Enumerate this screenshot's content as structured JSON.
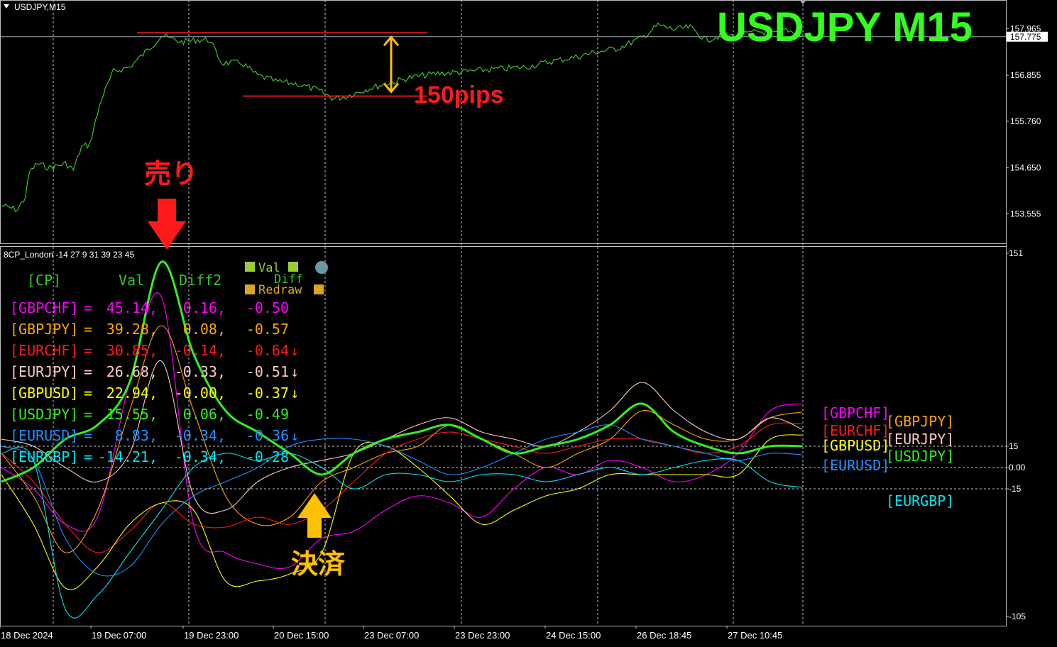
{
  "window": {
    "title": "USDJPY,M15",
    "big_title": "USDJPY  M15",
    "dropdown_icon": "triangle-down-icon"
  },
  "colors": {
    "background": "#000000",
    "price_line": "#3fbf2f",
    "big_title": "#33ff1f",
    "annotation_red": "#ff1a1a",
    "annotation_yellow": "#ffc000",
    "grid": "#c8c8c8"
  },
  "annotations": {
    "pips_label": "150pips",
    "sell_label": "売り",
    "settle_label": "決済"
  },
  "indicator": {
    "title": "8CP_London -14 27 9 31 39 23 45",
    "legend_val": "Val",
    "legend_diff": "Diff",
    "legend_redraw": "Redraw",
    "header": {
      "cp": "[CP]",
      "val": "Val",
      "diff2": "Diff2"
    },
    "rows": [
      {
        "name": "[GBPCHF]",
        "eq": "=",
        "val": "45.14,",
        "diff": "0.16,",
        "diff2": "-0.50",
        "arrow": "",
        "color": "#ff00ff"
      },
      {
        "name": "[GBPJPY]",
        "eq": "=",
        "val": "39.28,",
        "diff": "0.08,",
        "diff2": "-0.57",
        "arrow": "",
        "color": "#ffa500"
      },
      {
        "name": "[EURCHF]",
        "eq": "=",
        "val": "30.85,",
        "diff": "-0.14,",
        "diff2": "-0.64",
        "arrow": "↓",
        "color": "#ff1a1a"
      },
      {
        "name": "[EURJPY]",
        "eq": "=",
        "val": "26.68,",
        "diff": "-0.33,",
        "diff2": "-0.51",
        "arrow": "↓",
        "color": "#ffc8c8"
      },
      {
        "name": "[GBPUSD]",
        "eq": "=",
        "val": "22.94,",
        "diff": "-0.00,",
        "diff2": "-0.37",
        "arrow": "↓",
        "color": "#ffff00"
      },
      {
        "name": "[USDJPY]",
        "eq": "=",
        "val": "15.55,",
        "diff": "0.06,",
        "diff2": "-0.49",
        "arrow": "",
        "color": "#33ee22"
      },
      {
        "name": "[EURUSD]",
        "eq": "=",
        "val": "8.83,",
        "diff": "-0.34,",
        "diff2": "-0.36",
        "arrow": "↓",
        "color": "#1e90ff"
      },
      {
        "name": "[EURGBP]",
        "eq": "=",
        "val": "-14.21,",
        "diff": "-0.34,",
        "diff2": "-0.28",
        "arrow": "",
        "color": "#00e5ee"
      }
    ],
    "right_labels": [
      {
        "text": "[GBPCHF]",
        "color": "#ff00ff"
      },
      {
        "text": "[GBPJPY]",
        "color": "#ffa500"
      },
      {
        "text": "[EURCHF]",
        "color": "#ff1a1a"
      },
      {
        "text": "[EURJPY]",
        "color": "#ffc8c8"
      },
      {
        "text": "[GBPUSD]",
        "color": "#ffff00"
      },
      {
        "text": "[USDJPY]",
        "color": "#33ee22"
      },
      {
        "text": "[EURUSD]",
        "color": "#1e90ff"
      },
      {
        "text": "[EURGBP]",
        "color": "#00e5ee"
      }
    ]
  },
  "chart_data": [
    {
      "type": "line",
      "title": "USDJPY,M15",
      "y_ticks": [
        "157.965",
        "156.855",
        "155.760",
        "154.650",
        "153.555"
      ],
      "y_tick_values": [
        157.965,
        156.855,
        155.76,
        154.65,
        153.555
      ],
      "current_price": "157.775",
      "current_price_value": 157.775,
      "ylim": [
        152.9,
        158.6
      ],
      "levels": [
        157.87,
        156.36
      ],
      "x": [
        0,
        0.02,
        0.03,
        0.035,
        0.045,
        0.06,
        0.08,
        0.09,
        0.1,
        0.11,
        0.125,
        0.14,
        0.16,
        0.185,
        0.2,
        0.225,
        0.245,
        0.26,
        0.275,
        0.3,
        0.32,
        0.345,
        0.37,
        0.395,
        0.415,
        0.43,
        0.445,
        0.46,
        0.48,
        0.51,
        0.545,
        0.585,
        0.615,
        0.655,
        0.69,
        0.72,
        0.74,
        0.77,
        0.8,
        0.82,
        0.84,
        0.86,
        0.88,
        0.9,
        0.92,
        0.945,
        0.965,
        0.98,
        1.0
      ],
      "series": [
        {
          "values": [
            153.75,
            153.65,
            153.95,
            154.55,
            154.75,
            154.65,
            154.75,
            154.6,
            155.15,
            155.2,
            156.3,
            156.95,
            157.05,
            157.5,
            157.8,
            157.65,
            157.7,
            157.7,
            157.15,
            157.15,
            156.85,
            156.7,
            156.65,
            156.5,
            156.3,
            156.35,
            156.45,
            156.55,
            156.65,
            156.8,
            156.9,
            156.95,
            157.0,
            157.05,
            157.2,
            157.3,
            157.4,
            157.5,
            157.75,
            158.05,
            157.95,
            158.0,
            157.7,
            157.8,
            157.8,
            157.9,
            157.85,
            157.95,
            157.8
          ]
        }
      ]
    },
    {
      "type": "line",
      "title": "8CP_London -14 27 9 31 39 23 45",
      "y_ticks": [
        "151",
        "15",
        "0.00",
        "-15",
        "-105"
      ],
      "y_tick_values": [
        151,
        15,
        0,
        -15,
        -105
      ],
      "levels": [
        15,
        0,
        -15
      ],
      "ylim": [
        -107,
        151
      ],
      "x_ticks": [
        "18 Dec 2024",
        "19 Dec 07:00",
        "19 Dec 23:00",
        "20 Dec 15:00",
        "23 Dec 07:00",
        "23 Dec 23:00",
        "24 Dec 15:00",
        "26 Dec 18:45",
        "27 Dec 10:45"
      ],
      "x": [
        0,
        0.04,
        0.08,
        0.12,
        0.16,
        0.2,
        0.24,
        0.28,
        0.32,
        0.36,
        0.4,
        0.44,
        0.48,
        0.52,
        0.56,
        0.6,
        0.64,
        0.68,
        0.72,
        0.76,
        0.8,
        0.84,
        0.88,
        0.92,
        0.96,
        1.0
      ],
      "series": [
        {
          "name": "[GBPCHF]",
          "values": [
            0,
            -15,
            -40,
            -35,
            60,
            120,
            -40,
            -60,
            -68,
            -70,
            -50,
            -45,
            -30,
            -20,
            -25,
            -35,
            -15,
            0,
            -5,
            5,
            0,
            -10,
            -5,
            10,
            40,
            45
          ]
        },
        {
          "name": "[GBPJPY]",
          "values": [
            10,
            -20,
            -60,
            -30,
            40,
            100,
            40,
            -20,
            -40,
            -35,
            -10,
            0,
            10,
            15,
            30,
            20,
            10,
            0,
            10,
            20,
            40,
            30,
            20,
            20,
            35,
            39
          ]
        },
        {
          "name": "[EURCHF]",
          "values": [
            10,
            -10,
            -40,
            -60,
            -45,
            -25,
            -40,
            -42,
            -35,
            -40,
            -30,
            -10,
            10,
            20,
            25,
            20,
            15,
            10,
            15,
            20,
            20,
            15,
            10,
            15,
            30,
            31
          ]
        },
        {
          "name": "[EURJPY]",
          "values": [
            20,
            15,
            0,
            -10,
            10,
            75,
            -20,
            -30,
            -10,
            0,
            5,
            10,
            20,
            30,
            35,
            25,
            20,
            15,
            25,
            40,
            60,
            40,
            25,
            20,
            35,
            27
          ]
        },
        {
          "name": "[GBPUSD]",
          "values": [
            -5,
            -40,
            -85,
            -70,
            -40,
            -25,
            -30,
            -80,
            -80,
            -75,
            -60,
            10,
            15,
            0,
            -20,
            -40,
            -30,
            -20,
            -15,
            -5,
            -5,
            -5,
            -5,
            -5,
            20,
            23
          ]
        },
        {
          "name": "[USDJPY]",
          "values": [
            -10,
            0,
            20,
            30,
            60,
            145,
            80,
            40,
            25,
            10,
            -5,
            10,
            20,
            25,
            30,
            20,
            10,
            15,
            20,
            30,
            45,
            25,
            15,
            10,
            15,
            15
          ]
        },
        {
          "name": "[EURUSD]",
          "values": [
            15,
            5,
            -50,
            -75,
            -70,
            -40,
            -20,
            -10,
            0,
            15,
            20,
            20,
            15,
            5,
            -5,
            0,
            10,
            20,
            25,
            30,
            20,
            15,
            10,
            5,
            10,
            9
          ]
        },
        {
          "name": "[EURGBP]",
          "values": [
            10,
            5,
            -100,
            -90,
            -60,
            -30,
            0,
            10,
            5,
            10,
            0,
            -15,
            -5,
            -5,
            -10,
            -5,
            -5,
            -10,
            -5,
            0,
            -5,
            0,
            5,
            5,
            -10,
            -14
          ]
        }
      ]
    }
  ]
}
